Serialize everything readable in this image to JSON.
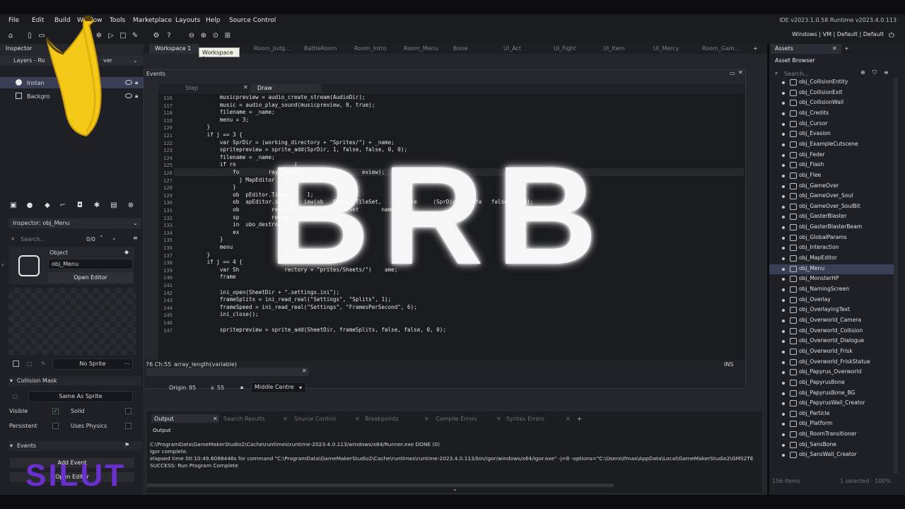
{
  "menubar": {
    "items": [
      "File",
      "Edit",
      "Build",
      "Window",
      "Tools",
      "Marketplace",
      "Layouts",
      "Help",
      "Source Control"
    ],
    "version": "IDE v2023.1.0.58 Runtime v2023.4.0.113",
    "config": "Windows | VM | Default | Default"
  },
  "left_panel": {
    "inspector_tab": "Inspector",
    "layers_header": "Layers - Ro",
    "layers_suffix": "ver",
    "layer_1": "Instan",
    "layer_2": "Backgro",
    "inspector_title": "Inspector: obj_Menu",
    "search_placeholder": "Search...",
    "count": "0/0",
    "object_label": "Object",
    "object_name": "obj_Menu",
    "open_editor": "Open Editor",
    "sprite": "No Sprite",
    "collision_mask": "Collision Mask",
    "same_as_sprite": "Same As Sprite",
    "visible": "Visible",
    "solid": "Solid",
    "persistent": "Persistent",
    "uses_physics": "Uses Physics",
    "events": "Events",
    "add_event": "Add Event",
    "open_editor_2": "Open Editor"
  },
  "workspace": {
    "tabs": [
      "Workspace 1",
      "Room_Judg...",
      "BattleRoom",
      "Room_Intro",
      "Room_Menu",
      "Bone",
      "UI_Act",
      "UI_Fight",
      "UI_Item",
      "UI_Mercy",
      "Room_Gam..."
    ],
    "tooltip": "Workspace 1",
    "events_title": "Events",
    "event_tabs": [
      "Step",
      "Draw"
    ],
    "status": "76 Ch:55",
    "status_hint": "array_length(variable)",
    "ins": "INS",
    "origin_label": "Origin",
    "origin_x": "95",
    "origin_sep": "x",
    "origin_y": "55",
    "origin_mode": "Middle Centre"
  },
  "code": {
    "line_numbers": [
      "116",
      "117",
      "118",
      "119",
      "120",
      "121",
      "122",
      "123",
      "124",
      "125",
      "126",
      "127",
      "128",
      "129",
      "130",
      "131",
      "132",
      "133",
      "134",
      "135",
      "136",
      "137",
      "138",
      "139",
      "140",
      "141",
      "142",
      "143",
      "144",
      "145",
      "146",
      "147"
    ],
    "lines": [
      "            musicpreview = audio_create_stream(AudioDir);",
      "            music = audio_play_sound(musicpreview, 0, true);",
      "            filename = _name;",
      "            menu = 3;",
      "        }",
      "        if j == 3 {",
      "            var SprDir = (working_directory + \"Sprites/\") + _name;",
      "            spritepreview = sprite_add(SprDir, 1, false, false, 0, 0);",
      "            filename = _name;",
      "            if ro                  (",
      "                fo         ray_length                   eview);",
      "                  j MapEditor   et = i;",
      "                }",
      "                ob  pEditor.TileSe     1;",
      "                ob  apEditor.sprite   iew(ob   Editor.TileSet,     sprite     (SprDir, 1,  fa   false, 0, 0);",
      "                ob          review(ob    Editor.TileSet       name;",
      "                sp          review);",
      "                in  ubo_destroy(",
      "                ex",
      "            }",
      "            menu",
      "        }",
      "        if j == 4 {",
      "            var Sh              rectory + \"prites/Sheets/\")    ame;",
      "            frame",
      "",
      "            ini_open(SheetDir + \".settings.ini\");",
      "            frameSplits = ini_read_real(\"Settings\", \"Splits\", 1);",
      "            frameSpeed = ini_read_real(\"Settings\", \"FramesPerSecond\", 6);",
      "            ini_close();",
      "",
      "            spritepreview = sprite_add(SheetDir, frameSplits, false, false, 0, 0);"
    ]
  },
  "overlay": {
    "brb": "BRB",
    "watermark": "SILUT"
  },
  "output": {
    "tabs": [
      "Output",
      "Search Results",
      "Source Control",
      "Breakpoints",
      "Compile Errors",
      "Syntax Errors"
    ],
    "subtitle": "Output",
    "lines": [
      "C:\\ProgramData\\GameMakerStudio2\\Cache\\runtimes\\runtime-2023.4.0.113/windows/x64/Runner.exe DONE (0)",
      "Igor complete.",
      "elapsed time 00:10:49.6088446s for command \"C:\\ProgramData\\GameMakerStudio2\\Cache\\runtimes\\runtime-2023.4.0.113/bin/igor/windows/x64/Igor.exe\" -j=8 -options=\"C:\\Users\\Ifmas\\AppData\\Local\\GameMakerStudio2\\GMS2TE",
      "SUCCESS: Run Program Complete"
    ]
  },
  "assets": {
    "tab": "Assets",
    "title": "Asset Browser",
    "search_placeholder": "Search...",
    "items": [
      "obj_CollisionEntity",
      "obj_CollisionExit",
      "obj_CollisionWall",
      "obj_Credits",
      "obj_Cursor",
      "obj_Evasion",
      "obj_ExampleCutscene",
      "obj_Feder",
      "obj_Flash",
      "obj_Flee",
      "obj_GameOver",
      "obj_GameOver_Soul",
      "obj_GameOver_SoulBit",
      "obj_GasterBlaster",
      "obj_GasterBlasterBeam",
      "obj_GlobalParams",
      "obj_Interaction",
      "obj_MapEditor",
      "obj_Menu",
      "obj_MonsterHP",
      "obj_NamingScreen",
      "obj_Overlay",
      "obj_OverlayingText",
      "obj_Overworld_Camera",
      "obj_Overworld_Collision",
      "obj_Overworld_Dialogue",
      "obj_Overworld_Frisk",
      "obj_Overworld_FriskStatue",
      "obj_Papyrus_Overworld",
      "obj_PapyrusBone",
      "obj_PapyrusBone_BG",
      "obj_PapyrusWall_Creator",
      "obj_Particle",
      "obj_Platform",
      "obj_RoomTransitioner",
      "obj_SansBone",
      "obj_SansWall_Creator"
    ],
    "selected": "obj_Menu",
    "footer_left": "156 items",
    "footer_right": "1 selected · 100%"
  }
}
